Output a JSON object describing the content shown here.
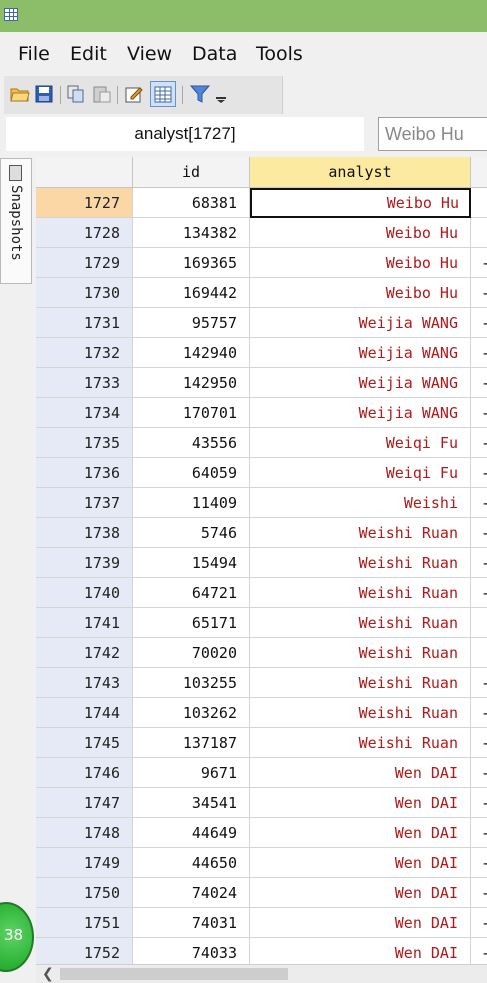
{
  "menu": [
    "File",
    "Edit",
    "View",
    "Data",
    "Tools"
  ],
  "varbar": {
    "varname": "analyst[1727]",
    "value": "Weibo Hu"
  },
  "sidebar": {
    "snapshots_label": "Snapshots"
  },
  "badge": {
    "count": "38"
  },
  "columns": {
    "id": "id",
    "analyst": "analyst"
  },
  "rows": [
    {
      "n": "1727",
      "id": "68381",
      "analyst": "Weibo Hu",
      "extra": ""
    },
    {
      "n": "1728",
      "id": "134382",
      "analyst": "Weibo Hu",
      "extra": ""
    },
    {
      "n": "1729",
      "id": "169365",
      "analyst": "Weibo Hu",
      "extra": "-"
    },
    {
      "n": "1730",
      "id": "169442",
      "analyst": "Weibo Hu",
      "extra": "-"
    },
    {
      "n": "1731",
      "id": "95757",
      "analyst": "Weijia WANG",
      "extra": "-"
    },
    {
      "n": "1732",
      "id": "142940",
      "analyst": "Weijia WANG",
      "extra": "-"
    },
    {
      "n": "1733",
      "id": "142950",
      "analyst": "Weijia WANG",
      "extra": "-"
    },
    {
      "n": "1734",
      "id": "170701",
      "analyst": "Weijia WANG",
      "extra": "-"
    },
    {
      "n": "1735",
      "id": "43556",
      "analyst": "Weiqi Fu",
      "extra": "-"
    },
    {
      "n": "1736",
      "id": "64059",
      "analyst": "Weiqi Fu",
      "extra": "-"
    },
    {
      "n": "1737",
      "id": "11409",
      "analyst": "Weishi",
      "extra": "-"
    },
    {
      "n": "1738",
      "id": "5746",
      "analyst": "Weishi Ruan",
      "extra": "-"
    },
    {
      "n": "1739",
      "id": "15494",
      "analyst": "Weishi Ruan",
      "extra": "-"
    },
    {
      "n": "1740",
      "id": "64721",
      "analyst": "Weishi Ruan",
      "extra": "-"
    },
    {
      "n": "1741",
      "id": "65171",
      "analyst": "Weishi Ruan",
      "extra": ""
    },
    {
      "n": "1742",
      "id": "70020",
      "analyst": "Weishi Ruan",
      "extra": ""
    },
    {
      "n": "1743",
      "id": "103255",
      "analyst": "Weishi Ruan",
      "extra": "-"
    },
    {
      "n": "1744",
      "id": "103262",
      "analyst": "Weishi Ruan",
      "extra": "-"
    },
    {
      "n": "1745",
      "id": "137187",
      "analyst": "Weishi Ruan",
      "extra": "-"
    },
    {
      "n": "1746",
      "id": "9671",
      "analyst": "Wen DAI",
      "extra": "-"
    },
    {
      "n": "1747",
      "id": "34541",
      "analyst": "Wen DAI",
      "extra": "-"
    },
    {
      "n": "1748",
      "id": "44649",
      "analyst": "Wen DAI",
      "extra": "-"
    },
    {
      "n": "1749",
      "id": "44650",
      "analyst": "Wen DAI",
      "extra": "-"
    },
    {
      "n": "1750",
      "id": "74024",
      "analyst": "Wen DAI",
      "extra": "-"
    },
    {
      "n": "1751",
      "id": "74031",
      "analyst": "Wen DAI",
      "extra": "-"
    },
    {
      "n": "1752",
      "id": "74033",
      "analyst": "Wen DAI",
      "extra": "-"
    }
  ],
  "selected_row": "1727",
  "colors": {
    "title_bar": "#8cbe6a",
    "text_red": "#b01a1a",
    "header_selected": "#fbeaa0",
    "row_selected": "#fbd7a6",
    "row_header": "#e6e9f6"
  },
  "icons": [
    "open-icon",
    "save-icon",
    "copy-icon",
    "paste-icon",
    "edit-icon",
    "browse-icon",
    "filter-icon",
    "toolbar-overflow-icon"
  ]
}
